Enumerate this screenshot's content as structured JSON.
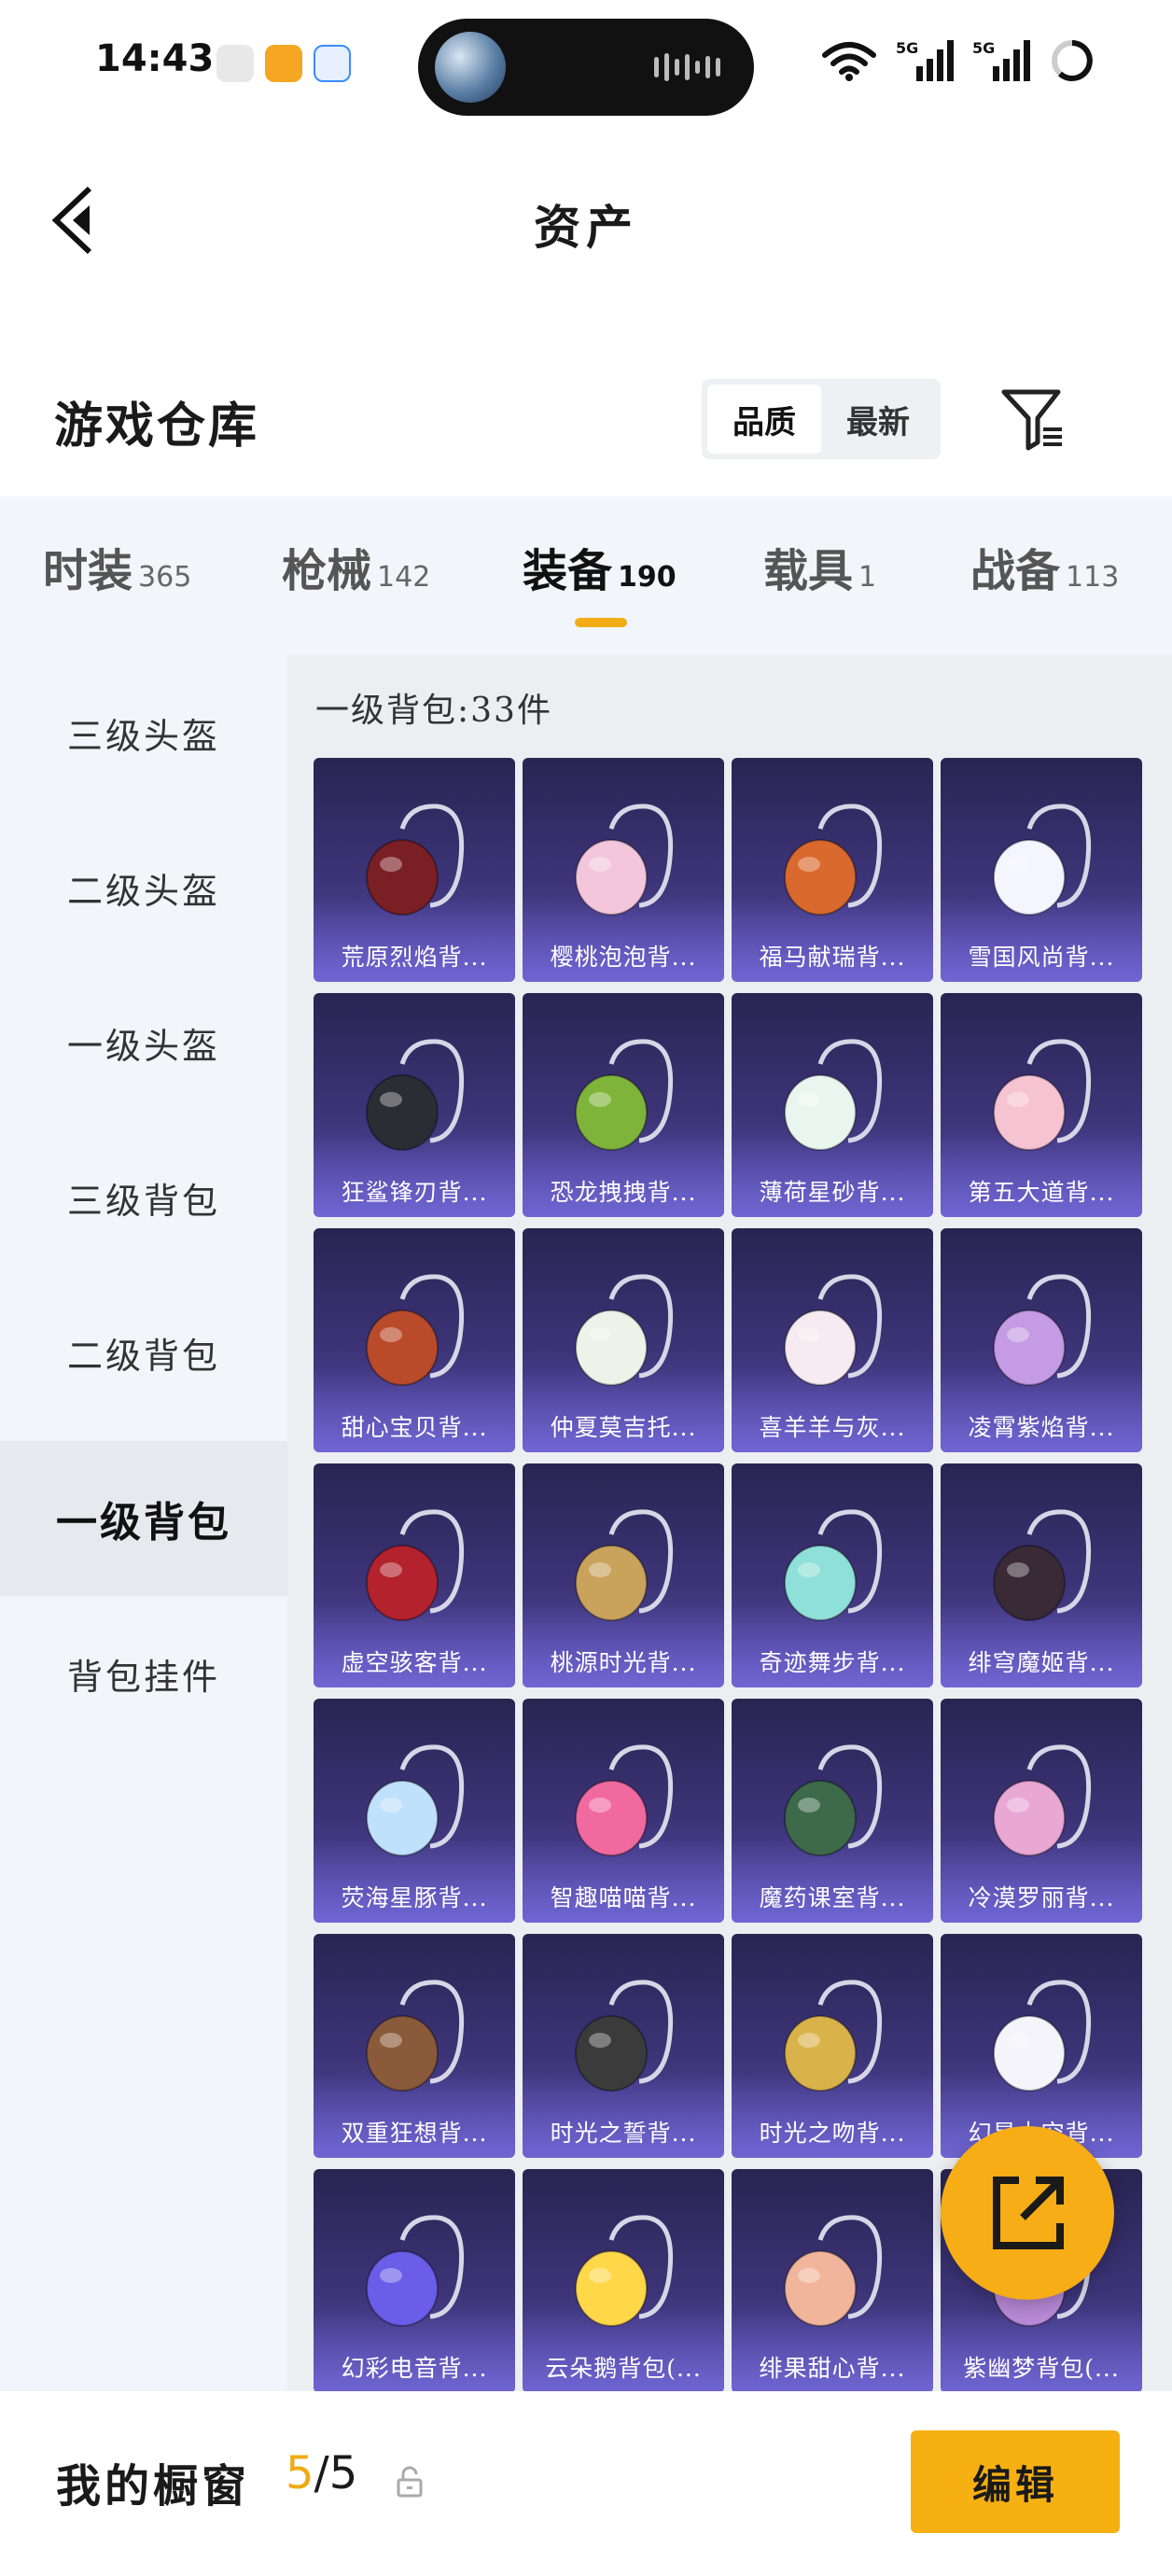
{
  "status_bar": {
    "time": "14:43",
    "app_icons": [
      "app-icon-a",
      "app-icon-b",
      "app-icon-c"
    ],
    "network_1": "5G",
    "network_2": "5G"
  },
  "header": {
    "title": "资产"
  },
  "warehouse": {
    "title": "游戏仓库",
    "sort_options": [
      "品质",
      "最新"
    ],
    "sort_selected": "品质"
  },
  "tabs": [
    {
      "label": "时装",
      "count": "365"
    },
    {
      "label": "枪械",
      "count": "142"
    },
    {
      "label": "装备",
      "count": "190"
    },
    {
      "label": "载具",
      "count": "1"
    },
    {
      "label": "战备",
      "count": "113"
    }
  ],
  "active_tab": "装备",
  "sidebar": [
    {
      "label": "三级头盔"
    },
    {
      "label": "二级头盔"
    },
    {
      "label": "一级头盔"
    },
    {
      "label": "三级背包"
    },
    {
      "label": "二级背包"
    },
    {
      "label": "一级背包"
    },
    {
      "label": "背包挂件"
    }
  ],
  "active_sidebar": "一级背包",
  "content": {
    "heading": "一级背包:33件",
    "items": [
      {
        "name": "荒原烈焰背...",
        "color": "#7a1f24"
      },
      {
        "name": "樱桃泡泡背...",
        "color": "#f3c6dc"
      },
      {
        "name": "福马献瑞背...",
        "color": "#d9692c"
      },
      {
        "name": "雪国风尚背...",
        "color": "#f4f6ff"
      },
      {
        "name": "狂鲨锋刃背...",
        "color": "#2c2c34"
      },
      {
        "name": "恐龙拽拽背...",
        "color": "#7fb43a"
      },
      {
        "name": "薄荷星砂背...",
        "color": "#e8f6ef"
      },
      {
        "name": "第五大道背...",
        "color": "#f6c3d3"
      },
      {
        "name": "甜心宝贝背...",
        "color": "#b94b2b"
      },
      {
        "name": "仲夏莫吉托...",
        "color": "#eef2e9"
      },
      {
        "name": "喜羊羊与灰...",
        "color": "#f5ebf0"
      },
      {
        "name": "凌霄紫焰背...",
        "color": "#c49be4"
      },
      {
        "name": "虚空骇客背...",
        "color": "#b3222d"
      },
      {
        "name": "桃源时光背...",
        "color": "#c9a35c"
      },
      {
        "name": "奇迹舞步背...",
        "color": "#8fe0d8"
      },
      {
        "name": "绯穹魔姬背...",
        "color": "#3a2a36"
      },
      {
        "name": "荧海星豚背...",
        "color": "#bfe1fb"
      },
      {
        "name": "智趣喵喵背...",
        "color": "#f06aa0"
      },
      {
        "name": "魔药课室背...",
        "color": "#3d6a4a"
      },
      {
        "name": "冷漠罗丽背...",
        "color": "#e9a7d4"
      },
      {
        "name": "双重狂想背...",
        "color": "#8a5a3a"
      },
      {
        "name": "时光之誓背...",
        "color": "#3b3b3b"
      },
      {
        "name": "时光之吻背...",
        "color": "#d9b24a"
      },
      {
        "name": "幻星太空背...",
        "color": "#f4f4fa"
      },
      {
        "name": "幻彩电音背...",
        "color": "#6a5de8"
      },
      {
        "name": "云朵鹅背包(...",
        "color": "#ffd84a"
      },
      {
        "name": "绯果甜心背...",
        "color": "#f1b59c"
      },
      {
        "name": "紫幽梦背包(...",
        "color": "#b98ad8"
      }
    ]
  },
  "bottom_bar": {
    "label": "我的橱窗",
    "current": "5",
    "separator": "/",
    "total": "5",
    "edit_label": "编辑"
  },
  "colors": {
    "accent": "#f6b012",
    "card_top": "#2a2452",
    "card_bottom": "#5a4fb0",
    "sidebar_bg": "#f2f5f9"
  }
}
